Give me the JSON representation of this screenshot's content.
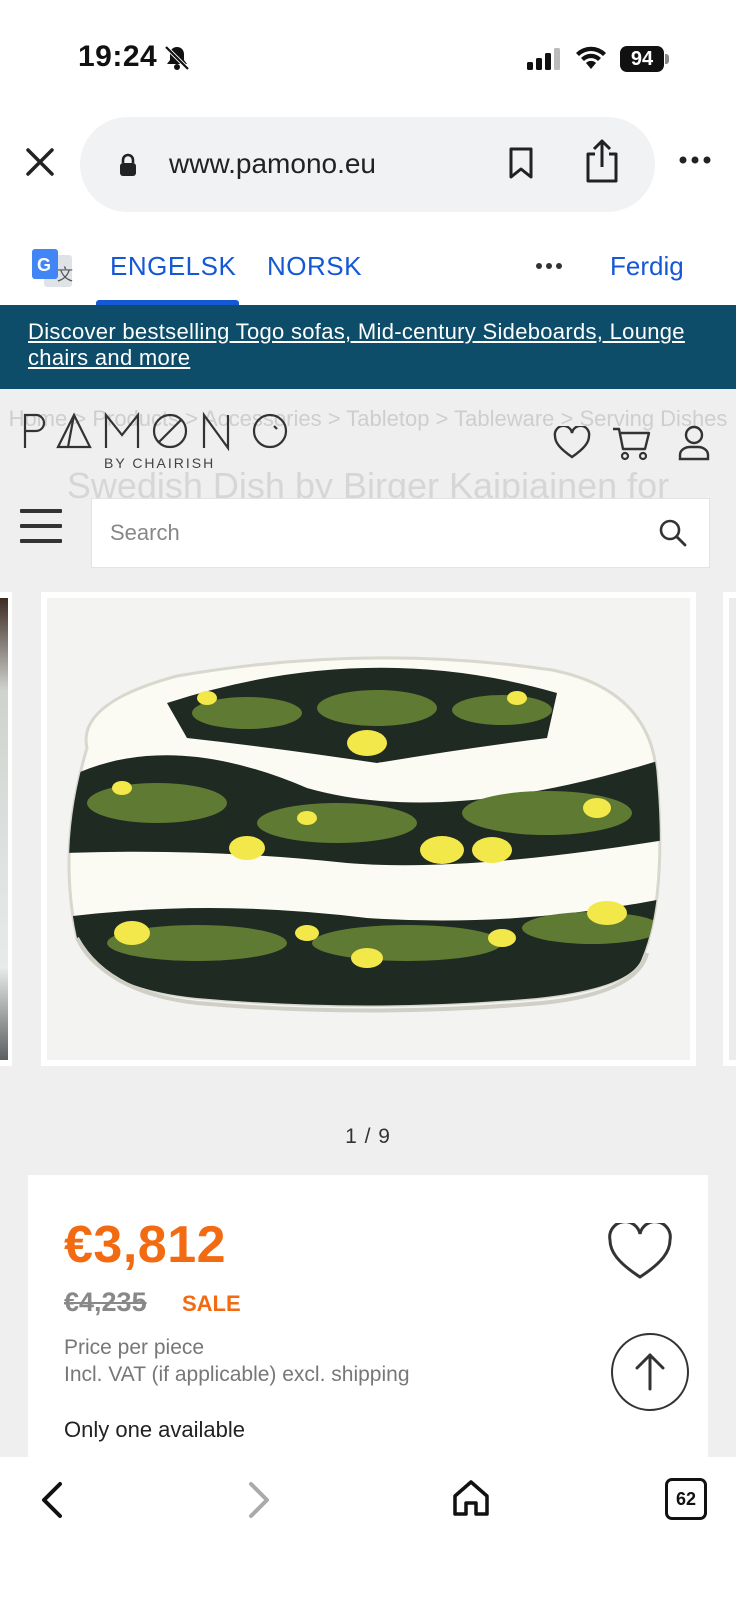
{
  "status_bar": {
    "time": "19:24",
    "battery": "94"
  },
  "browser": {
    "url": "www.pamono.eu"
  },
  "translate_bar": {
    "tab_english": "ENGELSK",
    "tab_norwegian": "NORSK",
    "done": "Ferdig"
  },
  "promo_banner": {
    "text": "Discover bestselling Togo sofas, Mid-century Sideboards, Lounge chairs and more"
  },
  "site_header": {
    "logo": "PAMONO",
    "logo_sub": "BY CHAIRISH",
    "search_placeholder": "Search",
    "breadcrumb": "Home > Products > Accessories > Tabletop > Tableware > Serving Dishes",
    "title": "Swedish Dish by Birger Kaipiainen for"
  },
  "gallery": {
    "pager": "1 / 9"
  },
  "price_card": {
    "price": "€3,812",
    "original_price": "€4,235",
    "sale_label": "SALE",
    "note_1": "Price per piece",
    "note_2": "Incl. VAT (if applicable) excl. shipping",
    "availability": "Only one available"
  },
  "bottom_bar": {
    "tab_count": "62"
  },
  "colors": {
    "brand_orange": "#f26a12",
    "banner_blue": "#0d4d6a",
    "link_blue": "#1558d6"
  }
}
